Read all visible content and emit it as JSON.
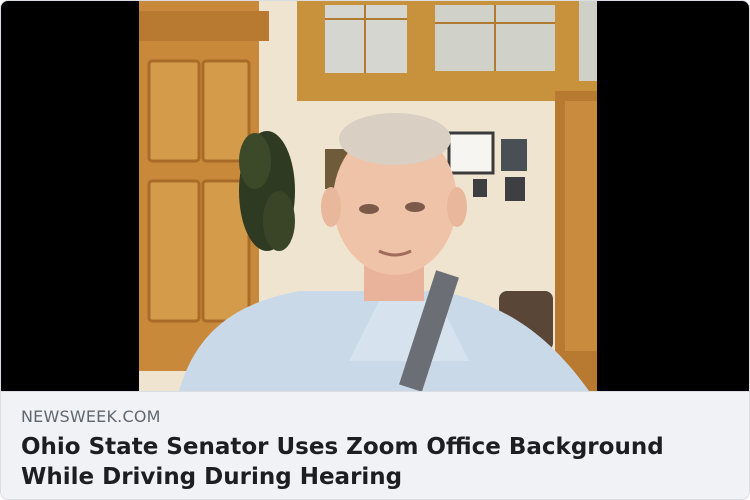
{
  "link_preview": {
    "image_alt": "Man on video call with office background",
    "domain": "NEWSWEEK.COM",
    "headline": "Ohio State Senator Uses Zoom Office Background While Driving During Hearing"
  },
  "colors": {
    "caption_background": "#f0f2f5",
    "domain_text": "#606770",
    "headline_text": "#1c1e21",
    "letterbox": "#000000"
  }
}
